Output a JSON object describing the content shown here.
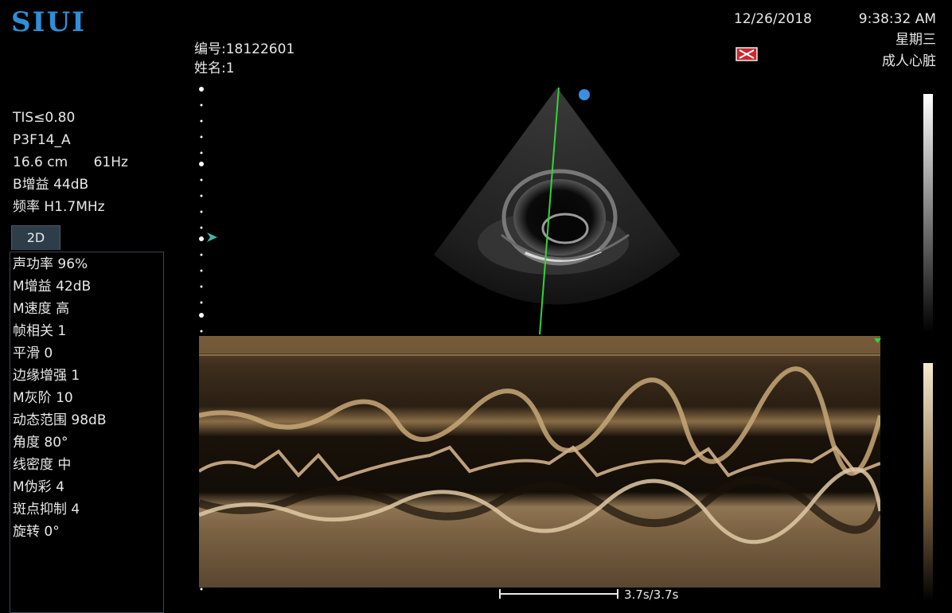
{
  "brand": {
    "logo_text": "SIUI"
  },
  "header": {
    "date": "12/26/2018",
    "time": "9:38:32 AM",
    "weekday": "星期三",
    "exam_preset": "成人心脏",
    "patient_id": "编号:18122601",
    "patient_name": "姓名:1",
    "status_icon": "freeze-indicator-icon"
  },
  "imaging_params": [
    "TIS≤0.80",
    "P3F14_A",
    "16.6 cm      61Hz",
    "B增益 44dB",
    "频率 H1.7MHz"
  ],
  "mode_tab": {
    "label": "2D"
  },
  "m_params": [
    "声功率 96%",
    "M增益 42dB",
    "M速度 高",
    "帧相关 1",
    "平滑 0",
    "边缘增强 1",
    "M灰阶 10",
    "动态范围 98dB",
    "角度 80°",
    "线密度 中",
    "M伪彩 4",
    "斑点抑制 4",
    "旋转 0°"
  ],
  "time_scale": {
    "label": "3.7s/3.7s"
  },
  "colors": {
    "logo": "#2f8fd6",
    "focus_marker": "#3fb8a8",
    "m_line": "#35d23a",
    "position_dot": "#3a8fe0",
    "m_mode_tint": "#b08a55"
  }
}
